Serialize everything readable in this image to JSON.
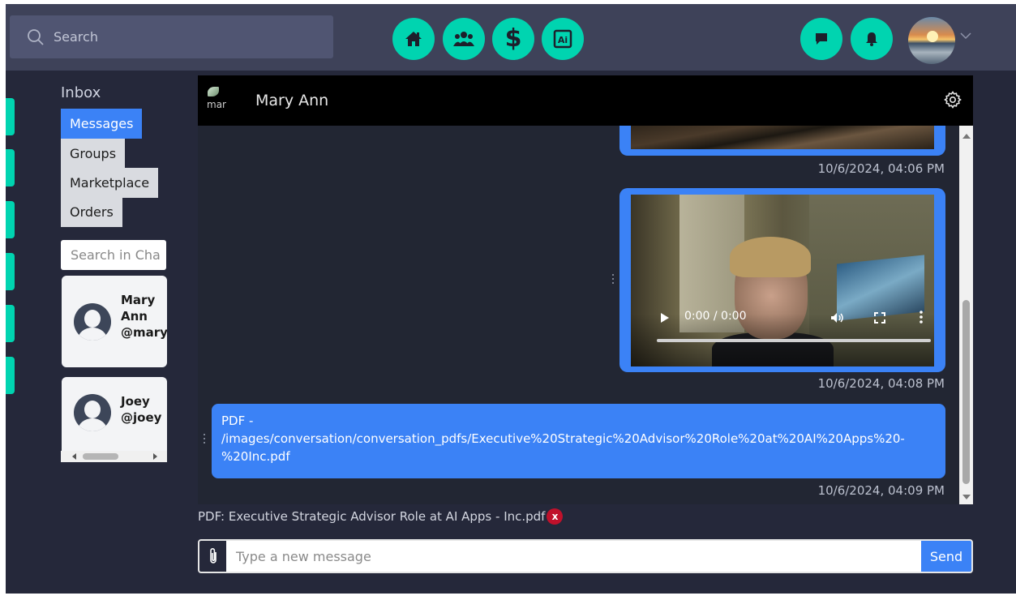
{
  "topbar": {
    "search_placeholder": "Search",
    "nav": [
      "home-icon",
      "friends-icon",
      "dollar-icon",
      "ai-icon"
    ],
    "dollar_glyph": "$",
    "ai_glyph": "Ai",
    "actions": [
      "chat-icon",
      "bell-icon"
    ],
    "accent": "#00d4b0"
  },
  "sidebar": {
    "title": "Inbox",
    "folders": [
      {
        "label": "Messages",
        "active": true
      },
      {
        "label": "Groups",
        "active": false
      },
      {
        "label": "Marketplace",
        "active": false
      },
      {
        "label": "Orders",
        "active": false
      }
    ],
    "search_placeholder": "Search in Cha",
    "contacts": [
      {
        "name_lines": [
          "Mary",
          "Ann",
          "@mary"
        ]
      },
      {
        "name_lines": [
          "Joey",
          "@joey"
        ]
      }
    ]
  },
  "chat": {
    "title": "Mary Ann",
    "avatar_alt": "mar",
    "messages": [
      {
        "type": "image",
        "timestamp": "10/6/2024, 04:06 PM"
      },
      {
        "type": "video",
        "time": "0:00 / 0:00",
        "timestamp": "10/6/2024, 04:08 PM"
      },
      {
        "type": "pdf",
        "lines": [
          "PDF -",
          "/images/conversation/conversation_pdfs/Executive%20Strategic%20Advisor%20Role%20at%20AI%20Apps%20-",
          "%20Inc.pdf"
        ],
        "timestamp": "10/6/2024, 04:09 PM"
      }
    ],
    "pending_attachment": "PDF: Executive Strategic Advisor Role at AI Apps - Inc.pdf",
    "remove_glyph": "x",
    "composer": {
      "placeholder": "Type a new message",
      "send_label": "Send"
    }
  }
}
